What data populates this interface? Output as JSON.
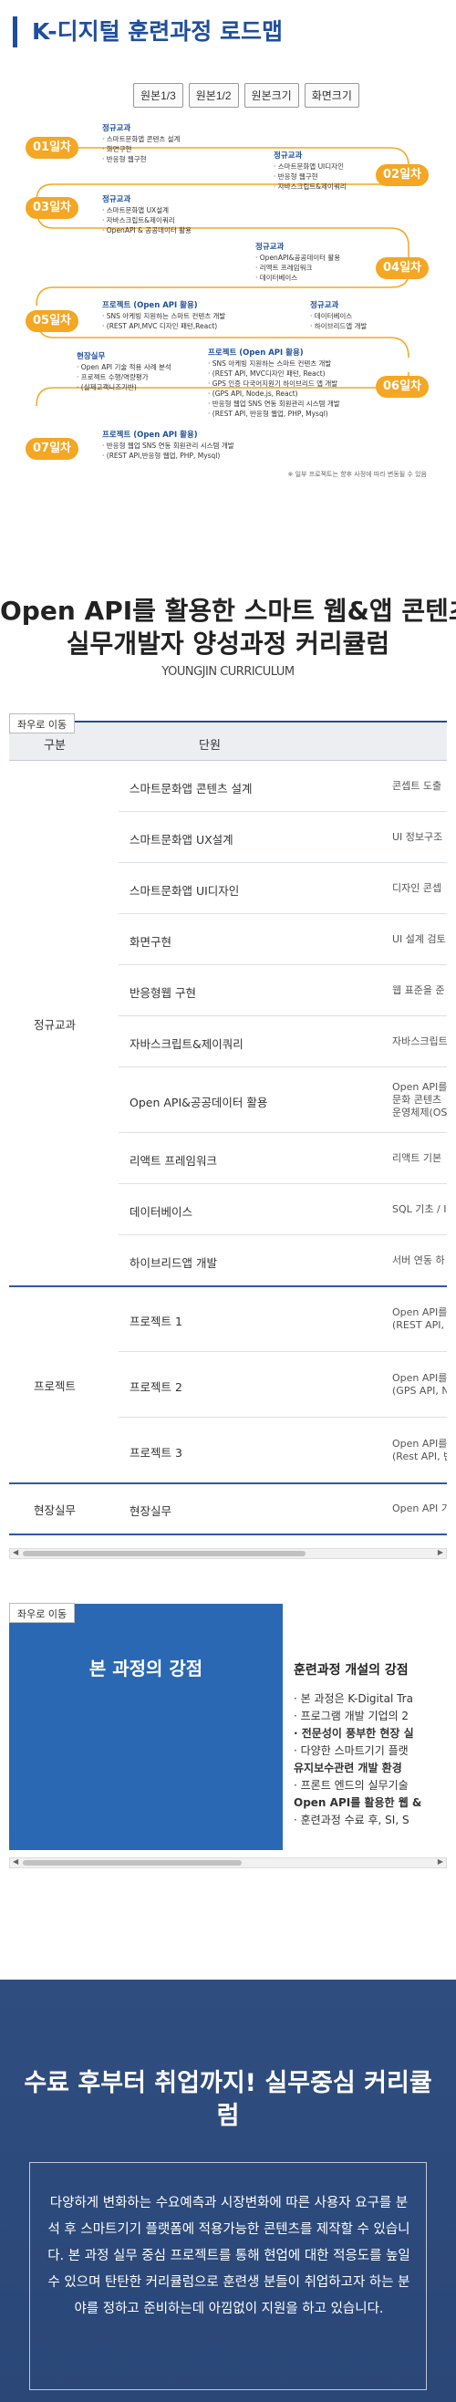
{
  "roadmap": {
    "title": "K-디지털 훈련과정 로드맵",
    "buttons": [
      "원본1/3",
      "원본1/2",
      "원본크기",
      "화면크기"
    ],
    "days": [
      "01일차",
      "02일차",
      "03일차",
      "04일차",
      "05일차",
      "06일차",
      "07일차"
    ],
    "blocks": [
      {
        "cat": "정규교과",
        "items": [
          "스마트문화앱 콘텐츠 설계",
          "화면구현",
          "반응형 웹구현"
        ]
      },
      {
        "cat": "정규교과",
        "items": [
          "스마트문화앱 UI디자인",
          "반응형 웹구현",
          "자바스크립트&제이쿼리"
        ]
      },
      {
        "cat": "정규교과",
        "items": [
          "스마트문화앱 UX설계",
          "자바스크립트&제이쿼리",
          "OpenAPI & 공공데이터 활용"
        ]
      },
      {
        "cat": "정규교과",
        "items": [
          "OpenAPI&공공데이터 활용",
          "리액트 프레임워크",
          "데이터베이스"
        ]
      },
      {
        "cat": "프로젝트 (Open API 활용)",
        "items": [
          "SNS 아케빙 지원하는 스마트 컨텐츠 개발",
          "(REST API,MVC 디자인 패턴,React)"
        ]
      },
      {
        "cat": "정규교과",
        "items": [
          "데이터베이스",
          "하이브리드앱 개발"
        ]
      },
      {
        "cat": "현장실무",
        "items": [
          "Open API 기술 적용 사례 분석",
          "프로젝트 수행/역량평가",
          "(실제고객니즈기반)"
        ]
      },
      {
        "cat": "프로젝트 (Open API 활용)",
        "items": [
          "SNS 아케빙 지원하는 스마트 컨텐츠 개발",
          "(REST API, MVC디자인 패턴, React)",
          "GPS 인증 다국어지원기 하이브리드 앱 개발",
          "(GPS API, Node.js, React)",
          "반응형 웹업 SNS 연동 회원관리 시스템 개발",
          "(REST API, 반응형 웹업, PHP, Mysql)"
        ]
      },
      {
        "cat": "프로젝트 (Open API 활용)",
        "items": [
          "반응형 웹업 SNS 연동 회원관리 시스템 개발",
          "(REST API,반응형 웹업, PHP, Mysql)"
        ]
      }
    ],
    "note": "※ 일부 프로젝트는 향후 사정에 따라 변동될 수 있음"
  },
  "curriculum": {
    "title_line1": "Open API를 활용한 스마트 웹&앱 콘텐츠",
    "title_line2": "실무개발자 양성과정 커리큘럼",
    "subtitle": "YOUNGJIN CURRICULUM",
    "scroll_hint": "좌우로 이동",
    "header": {
      "category": "구분",
      "unit": "단원"
    },
    "groups": [
      {
        "category": "정규교과",
        "rows": [
          {
            "unit": "스마트문화앱 콘텐츠 설계",
            "desc": [
              "콘셉트 도출"
            ]
          },
          {
            "unit": "스마트문화앱 UX설계",
            "desc": [
              "UI 정보구조"
            ]
          },
          {
            "unit": "스마트문화앱 UI디자인",
            "desc": [
              "디자인 콘셉"
            ]
          },
          {
            "unit": "화면구현",
            "desc": [
              "UI 설계 검토"
            ]
          },
          {
            "unit": "반응형웹 구현",
            "desc": [
              "웹 표준을 준"
            ]
          },
          {
            "unit": "자바스크립트&제이쿼리",
            "desc": [
              "자바스크립트"
            ]
          },
          {
            "unit": "Open API&공공데이터 활용",
            "desc": [
              "Open API를",
              "문화 콘텐츠",
              "운영체제(OS"
            ]
          },
          {
            "unit": "리액트 프레임워크",
            "desc": [
              "리액트 기본"
            ]
          },
          {
            "unit": "데이터베이스",
            "desc": [
              "SQL 기초 / I"
            ]
          },
          {
            "unit": "하이브리드앱 개발",
            "desc": [
              "서버 연동 하"
            ]
          }
        ]
      },
      {
        "category": "프로젝트",
        "rows": [
          {
            "unit": "프로젝트 1",
            "desc": [
              "Open API를",
              "(REST API, M"
            ]
          },
          {
            "unit": "프로젝트 2",
            "desc": [
              "Open API를",
              "(GPS API, No"
            ]
          },
          {
            "unit": "프로젝트 3",
            "desc": [
              "Open API를",
              "(Rest API, 반"
            ]
          }
        ]
      },
      {
        "category": "현장실무",
        "rows": [
          {
            "unit": "현장실무",
            "desc": [
              "Open API 기"
            ]
          }
        ]
      }
    ]
  },
  "strength": {
    "scroll_hint": "좌우로 이동",
    "left_title": "본 과정의 강점",
    "right_title": "훈련과정 개설의 강점",
    "items": [
      "· 본 과정은 K-Digital Tra",
      "· 프로그램 개발 기업의 2",
      "· 전문성이 풍부한 현장 실",
      "· 다양한 스마트기기 플랫",
      "유지보수관련 개발 환경",
      "· 프론트 엔드의 실무기술",
      "Open API를 활용한 웹 &",
      "· 훈련과정 수료 후, SI, S"
    ]
  },
  "banner": {
    "title": "수료 후부터 취업까지! 실무중심 커리큘럼",
    "paragraph": "다양하게 변화하는 수요예측과 시장변화에 따른 사용자 요구를 분석 후 스마트기기 플랫폼에 적용가능한 콘텐츠를 제작할 수 있습니다. 본 과정 실무 중심 프로젝트를 통해 현업에 대한 적응도를 높일 수 있으며 탄탄한 커리큘럼으로 훈련생 분들이 취업하고자 하는 분야를 정하고 준비하는데 아낌없이 지원을 하고 있습니다."
  },
  "colors": {
    "accent": "#1f4e9c",
    "day_badge": "#f5a623",
    "strength_blue": "#2a68b3",
    "banner_bg": "#2f4d7f"
  }
}
